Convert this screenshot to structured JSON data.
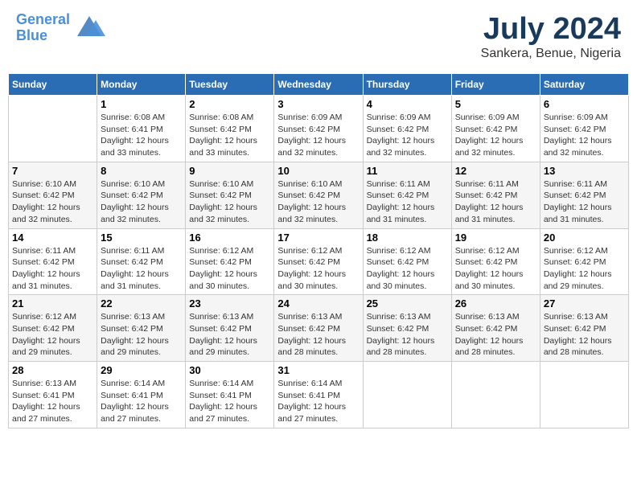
{
  "header": {
    "logo_line1": "General",
    "logo_line2": "Blue",
    "main_title": "July 2024",
    "subtitle": "Sankera, Benue, Nigeria"
  },
  "calendar": {
    "days_of_week": [
      "Sunday",
      "Monday",
      "Tuesday",
      "Wednesday",
      "Thursday",
      "Friday",
      "Saturday"
    ],
    "weeks": [
      [
        {
          "day": "",
          "info": ""
        },
        {
          "day": "1",
          "info": "Sunrise: 6:08 AM\nSunset: 6:41 PM\nDaylight: 12 hours\nand 33 minutes."
        },
        {
          "day": "2",
          "info": "Sunrise: 6:08 AM\nSunset: 6:42 PM\nDaylight: 12 hours\nand 33 minutes."
        },
        {
          "day": "3",
          "info": "Sunrise: 6:09 AM\nSunset: 6:42 PM\nDaylight: 12 hours\nand 32 minutes."
        },
        {
          "day": "4",
          "info": "Sunrise: 6:09 AM\nSunset: 6:42 PM\nDaylight: 12 hours\nand 32 minutes."
        },
        {
          "day": "5",
          "info": "Sunrise: 6:09 AM\nSunset: 6:42 PM\nDaylight: 12 hours\nand 32 minutes."
        },
        {
          "day": "6",
          "info": "Sunrise: 6:09 AM\nSunset: 6:42 PM\nDaylight: 12 hours\nand 32 minutes."
        }
      ],
      [
        {
          "day": "7",
          "info": "Sunrise: 6:10 AM\nSunset: 6:42 PM\nDaylight: 12 hours\nand 32 minutes."
        },
        {
          "day": "8",
          "info": "Sunrise: 6:10 AM\nSunset: 6:42 PM\nDaylight: 12 hours\nand 32 minutes."
        },
        {
          "day": "9",
          "info": "Sunrise: 6:10 AM\nSunset: 6:42 PM\nDaylight: 12 hours\nand 32 minutes."
        },
        {
          "day": "10",
          "info": "Sunrise: 6:10 AM\nSunset: 6:42 PM\nDaylight: 12 hours\nand 32 minutes."
        },
        {
          "day": "11",
          "info": "Sunrise: 6:11 AM\nSunset: 6:42 PM\nDaylight: 12 hours\nand 31 minutes."
        },
        {
          "day": "12",
          "info": "Sunrise: 6:11 AM\nSunset: 6:42 PM\nDaylight: 12 hours\nand 31 minutes."
        },
        {
          "day": "13",
          "info": "Sunrise: 6:11 AM\nSunset: 6:42 PM\nDaylight: 12 hours\nand 31 minutes."
        }
      ],
      [
        {
          "day": "14",
          "info": "Sunrise: 6:11 AM\nSunset: 6:42 PM\nDaylight: 12 hours\nand 31 minutes."
        },
        {
          "day": "15",
          "info": "Sunrise: 6:11 AM\nSunset: 6:42 PM\nDaylight: 12 hours\nand 31 minutes."
        },
        {
          "day": "16",
          "info": "Sunrise: 6:12 AM\nSunset: 6:42 PM\nDaylight: 12 hours\nand 30 minutes."
        },
        {
          "day": "17",
          "info": "Sunrise: 6:12 AM\nSunset: 6:42 PM\nDaylight: 12 hours\nand 30 minutes."
        },
        {
          "day": "18",
          "info": "Sunrise: 6:12 AM\nSunset: 6:42 PM\nDaylight: 12 hours\nand 30 minutes."
        },
        {
          "day": "19",
          "info": "Sunrise: 6:12 AM\nSunset: 6:42 PM\nDaylight: 12 hours\nand 30 minutes."
        },
        {
          "day": "20",
          "info": "Sunrise: 6:12 AM\nSunset: 6:42 PM\nDaylight: 12 hours\nand 29 minutes."
        }
      ],
      [
        {
          "day": "21",
          "info": "Sunrise: 6:12 AM\nSunset: 6:42 PM\nDaylight: 12 hours\nand 29 minutes."
        },
        {
          "day": "22",
          "info": "Sunrise: 6:13 AM\nSunset: 6:42 PM\nDaylight: 12 hours\nand 29 minutes."
        },
        {
          "day": "23",
          "info": "Sunrise: 6:13 AM\nSunset: 6:42 PM\nDaylight: 12 hours\nand 29 minutes."
        },
        {
          "day": "24",
          "info": "Sunrise: 6:13 AM\nSunset: 6:42 PM\nDaylight: 12 hours\nand 28 minutes."
        },
        {
          "day": "25",
          "info": "Sunrise: 6:13 AM\nSunset: 6:42 PM\nDaylight: 12 hours\nand 28 minutes."
        },
        {
          "day": "26",
          "info": "Sunrise: 6:13 AM\nSunset: 6:42 PM\nDaylight: 12 hours\nand 28 minutes."
        },
        {
          "day": "27",
          "info": "Sunrise: 6:13 AM\nSunset: 6:42 PM\nDaylight: 12 hours\nand 28 minutes."
        }
      ],
      [
        {
          "day": "28",
          "info": "Sunrise: 6:13 AM\nSunset: 6:41 PM\nDaylight: 12 hours\nand 27 minutes."
        },
        {
          "day": "29",
          "info": "Sunrise: 6:14 AM\nSunset: 6:41 PM\nDaylight: 12 hours\nand 27 minutes."
        },
        {
          "day": "30",
          "info": "Sunrise: 6:14 AM\nSunset: 6:41 PM\nDaylight: 12 hours\nand 27 minutes."
        },
        {
          "day": "31",
          "info": "Sunrise: 6:14 AM\nSunset: 6:41 PM\nDaylight: 12 hours\nand 27 minutes."
        },
        {
          "day": "",
          "info": ""
        },
        {
          "day": "",
          "info": ""
        },
        {
          "day": "",
          "info": ""
        }
      ]
    ]
  }
}
